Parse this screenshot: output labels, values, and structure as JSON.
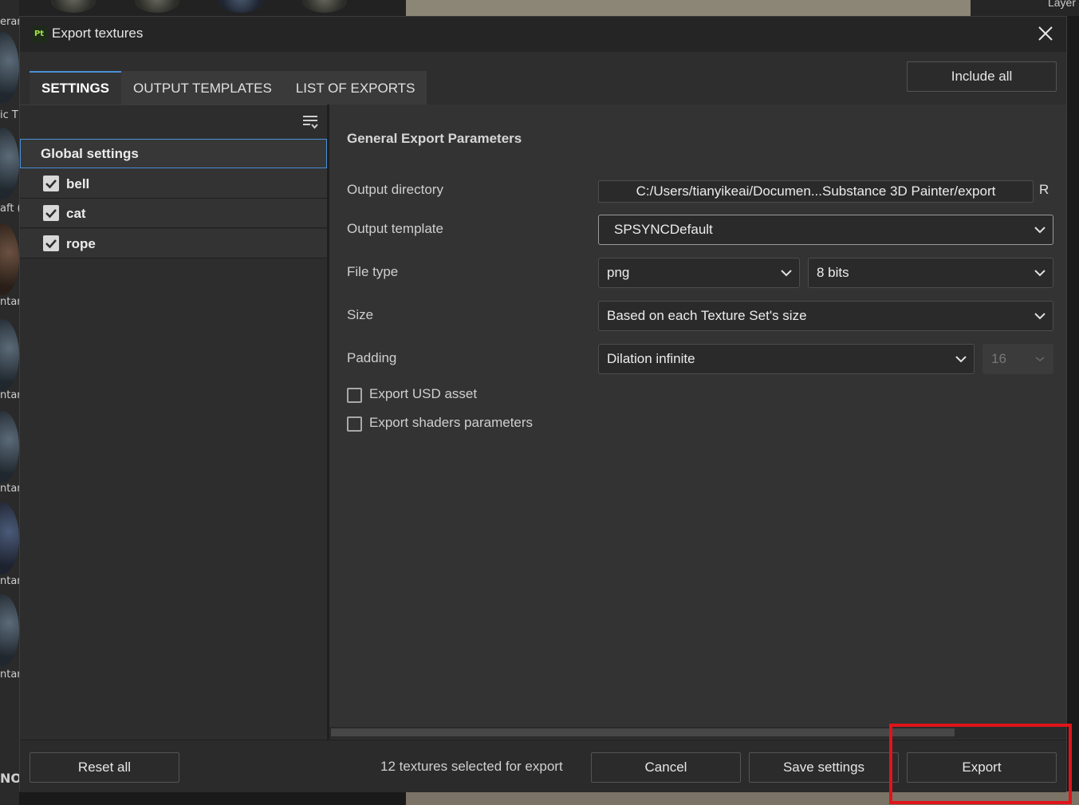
{
  "dialog": {
    "title": "Export textures",
    "app_icon": "Pt"
  },
  "tabs": [
    "SETTINGS",
    "OUTPUT TEMPLATES",
    "LIST OF EXPORTS"
  ],
  "include_all_label": "Include all",
  "sidebar": {
    "global": "Global settings",
    "items": [
      {
        "label": "bell",
        "checked": true
      },
      {
        "label": "cat",
        "checked": true
      },
      {
        "label": "rope",
        "checked": true
      }
    ]
  },
  "params": {
    "section_title": "General Export Parameters",
    "output_directory_label": "Output directory",
    "output_directory_value": "C:/Users/tianyikeai/Documen...Substance 3D Painter/export",
    "output_directory_button": "R",
    "output_template_label": "Output template",
    "output_template_value": "SPSYNCDefault",
    "file_type_label": "File type",
    "file_type_value": "png",
    "bit_depth_value": "8 bits",
    "size_label": "Size",
    "size_value": "Based on each Texture Set's size",
    "padding_label": "Padding",
    "padding_value": "Dilation infinite",
    "padding_amount": "16",
    "export_usd_label": "Export USD asset",
    "export_usd_checked": false,
    "export_shaders_label": "Export shaders parameters",
    "export_shaders_checked": false
  },
  "footer": {
    "reset_label": "Reset all",
    "status": "12 textures selected for export",
    "cancel_label": "Cancel",
    "save_label": "Save settings",
    "export_label": "Export"
  },
  "background": {
    "left_labels": [
      "erar",
      "ic T",
      "aft (",
      "ntar",
      "ntar",
      "ntar",
      "ntar",
      "ntar",
      "NO"
    ],
    "top_right_label": "Layer"
  },
  "colors": {
    "accent": "#4a90d9",
    "highlight": "#e0141a",
    "dialog_bg": "#2e2e2e"
  }
}
